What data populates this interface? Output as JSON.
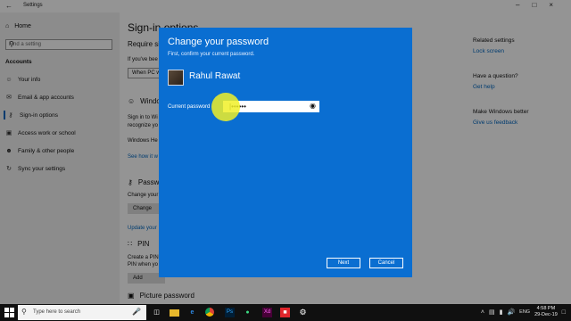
{
  "window": {
    "title": "Settings"
  },
  "leftnav": {
    "home": "Home",
    "search_placeholder": "Find a setting",
    "section": "Accounts",
    "items": [
      {
        "label": "Your info",
        "icon": "person-icon"
      },
      {
        "label": "Email & app accounts",
        "icon": "mail-icon"
      },
      {
        "label": "Sign-in options",
        "icon": "key-icon"
      },
      {
        "label": "Access work or school",
        "icon": "briefcase-icon"
      },
      {
        "label": "Family & other people",
        "icon": "people-icon"
      },
      {
        "label": "Sync your settings",
        "icon": "sync-icon"
      }
    ]
  },
  "main": {
    "title": "Sign-in options",
    "require_heading": "Require si",
    "require_text": "If you've bee",
    "dropdown_value": "When PC w",
    "windows_hello_heading": "Windo",
    "hello_text_1": "Sign in to Wi",
    "hello_text_2": "recognize yo",
    "hello_text_3": "Windows He",
    "see_how_link": "See how it w",
    "password_heading": "Passw",
    "password_text": "Change your",
    "change_button": "Change",
    "update_link": "Update your",
    "pin_heading": "PIN",
    "pin_text_1": "Create a PIN",
    "pin_text_2": "PIN when yo",
    "add_button": "Add",
    "picture_password_heading": "Picture password"
  },
  "rightcol": {
    "related_heading": "Related settings",
    "lock_screen_link": "Lock screen",
    "question_heading": "Have a question?",
    "get_help_link": "Get help",
    "better_heading": "Make Windows better",
    "feedback_link": "Give us feedback"
  },
  "dialog": {
    "title": "Change your password",
    "subtitle": "First, confirm your current password.",
    "user_name": "Rahul Rawat",
    "password_label": "Current password",
    "password_value": "|••••••",
    "next_button": "Next",
    "cancel_button": "Cancel"
  },
  "taskbar": {
    "search_placeholder": "Type here to search",
    "lang": "ENG",
    "time": "4:58 PM",
    "date": "29-Dec-19"
  }
}
